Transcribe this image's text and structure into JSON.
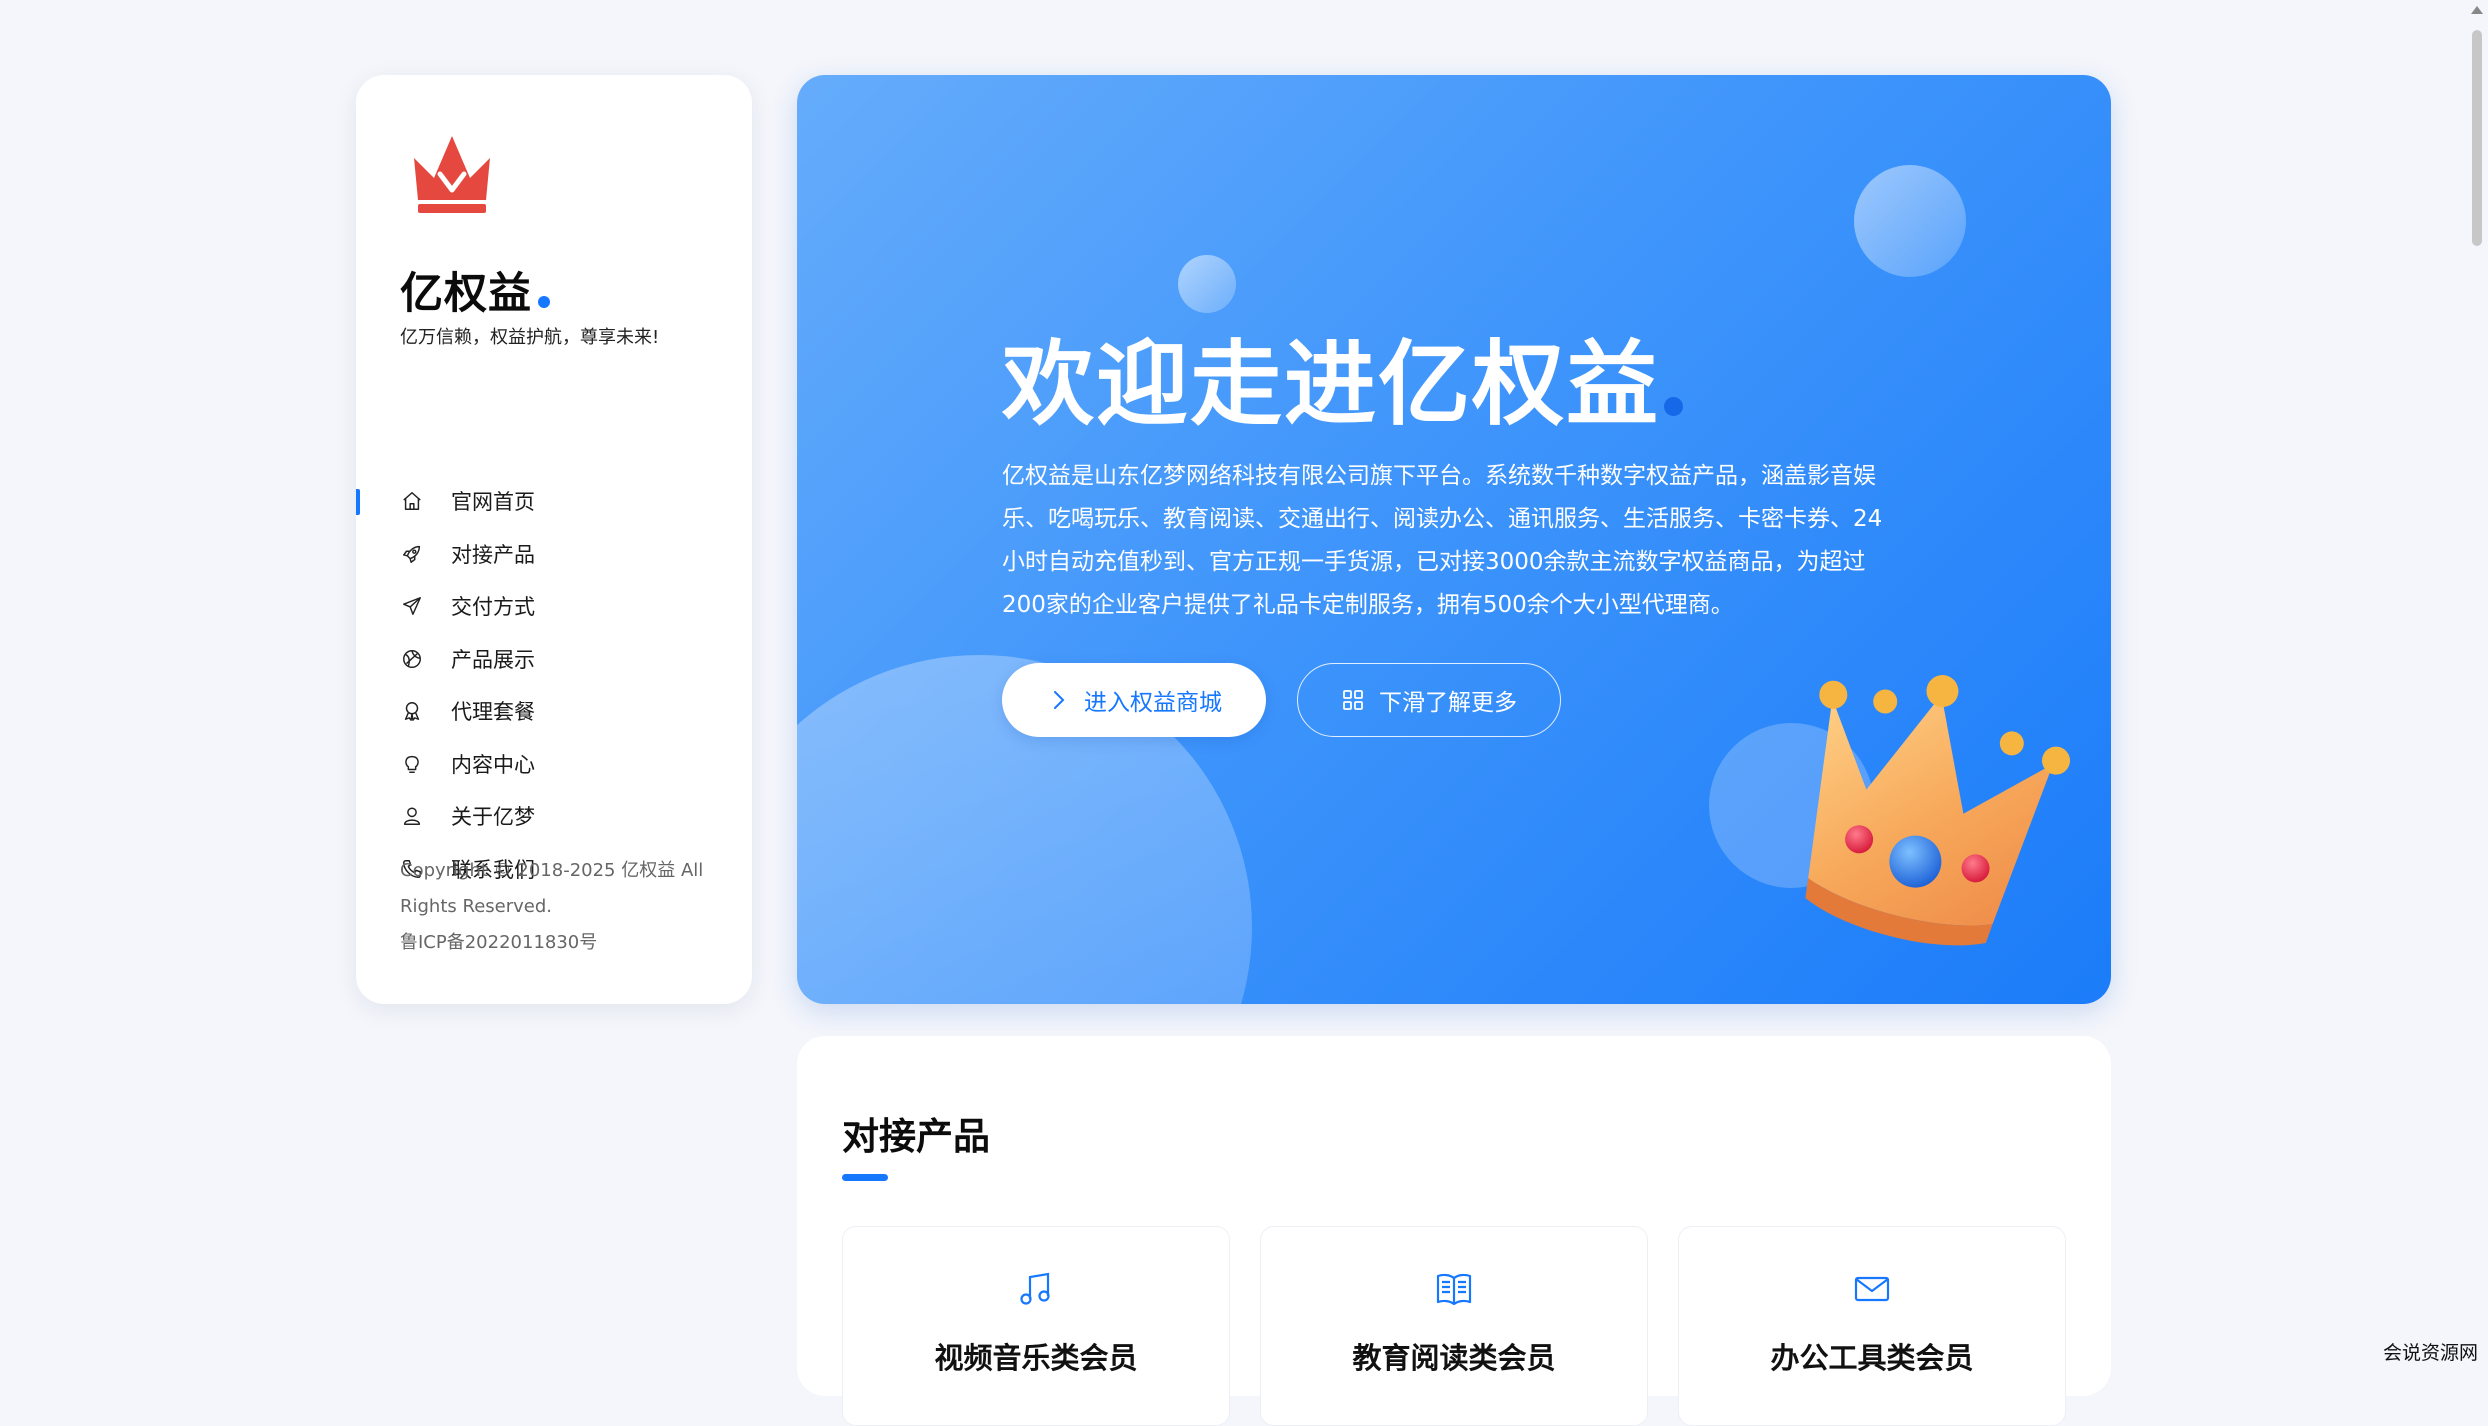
{
  "sidebar": {
    "brand_name": "亿权益",
    "slogan": "亿万信赖，权益护航，尊享未来!",
    "nav_items": [
      {
        "label": "官网首页",
        "icon": "home-icon",
        "active": true
      },
      {
        "label": "对接产品",
        "icon": "rocket-icon",
        "active": false
      },
      {
        "label": "交付方式",
        "icon": "paper-plane-icon",
        "active": false
      },
      {
        "label": "产品展示",
        "icon": "globe-icon",
        "active": false
      },
      {
        "label": "代理套餐",
        "icon": "award-ribbon-icon",
        "active": false
      },
      {
        "label": "内容中心",
        "icon": "lightbulb-icon",
        "active": false
      },
      {
        "label": "关于亿梦",
        "icon": "user-icon",
        "active": false
      },
      {
        "label": "联系我们",
        "icon": "phone-icon",
        "active": false
      }
    ],
    "copyright_line1": "Copyright © 2018-2025 亿权益 All Rights Reserved.",
    "icp": "鲁ICP备2022011830号"
  },
  "hero": {
    "title": "欢迎走进亿权益",
    "description": "亿权益是山东亿梦网络科技有限公司旗下平台。系统数千种数字权益产品，涵盖影音娱乐、吃喝玩乐、教育阅读、交通出行、阅读办公、通讯服务、生活服务、卡密卡券、24小时自动充值秒到、官方正规一手货源，已对接3000余款主流数字权益商品，为超过200家的企业客户提供了礼品卡定制服务，拥有500余个大小型代理商。",
    "primary_button": "进入权益商城",
    "secondary_button": "下滑了解更多"
  },
  "products": {
    "title": "对接产品",
    "cards": [
      {
        "title": "视频音乐类会员",
        "icon": "music-note-icon"
      },
      {
        "title": "教育阅读类会员",
        "icon": "book-icon"
      },
      {
        "title": "办公工具类会员",
        "icon": "mail-icon"
      }
    ]
  },
  "watermark": "会说资源网",
  "colors": {
    "accent": "#1677ff",
    "hero_gradient_start": "#65acfb",
    "hero_gradient_end": "#1b7cf9",
    "logo_red": "#e5483f"
  }
}
